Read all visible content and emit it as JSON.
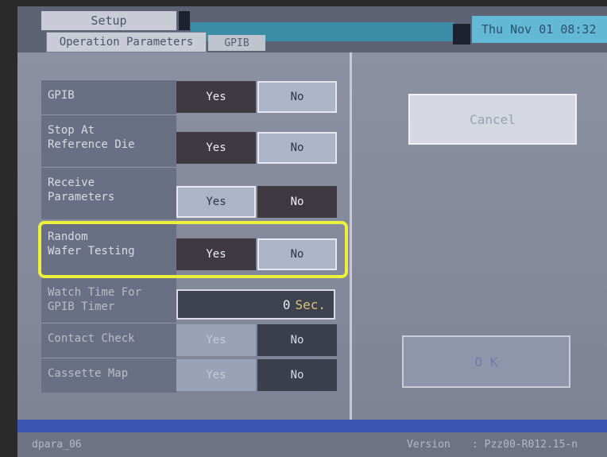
{
  "header": {
    "title_tab": "Setup",
    "tabs": [
      {
        "label": "Operation Parameters",
        "active": true
      },
      {
        "label": "GPIB",
        "active": false
      }
    ],
    "datetime": "Thu Nov 01 08:32"
  },
  "params": [
    {
      "label_line1": "GPIB",
      "label_line2": "",
      "yes": "Yes",
      "no": "No",
      "selected": "Yes",
      "enabled": true
    },
    {
      "label_line1": "Stop At",
      "label_line2": "Reference Die",
      "yes": "Yes",
      "no": "No",
      "selected": "Yes",
      "enabled": true
    },
    {
      "label_line1": "Receive",
      "label_line2": "Parameters",
      "yes": "Yes",
      "no": "No",
      "selected": "No",
      "enabled": true
    },
    {
      "label_line1": "Random",
      "label_line2": "Wafer Testing",
      "yes": "Yes",
      "no": "No",
      "selected": "Yes",
      "enabled": true,
      "highlighted": true
    },
    {
      "label_line1": "Contact Check",
      "label_line2": "",
      "yes": "Yes",
      "no": "No",
      "selected": "No",
      "enabled": false
    },
    {
      "label_line1": "Cassette Map",
      "label_line2": "",
      "yes": "Yes",
      "no": "No",
      "selected": "No",
      "enabled": false
    }
  ],
  "timer": {
    "label_line1": "Watch Time For",
    "label_line2": "GPIB Timer",
    "value": "0",
    "unit": "Sec."
  },
  "buttons": {
    "cancel": "Cancel",
    "ok": "O K"
  },
  "status": {
    "screen_id": "dpara_06",
    "version_label": "Version",
    "version_value": ": Pzz00-R012.15-n"
  },
  "colors": {
    "highlight": "#ecf03a",
    "selected_bg": "#3f3a42",
    "unselected_bg": "#aeb4c8",
    "accent_bar": "#3b56b0"
  }
}
